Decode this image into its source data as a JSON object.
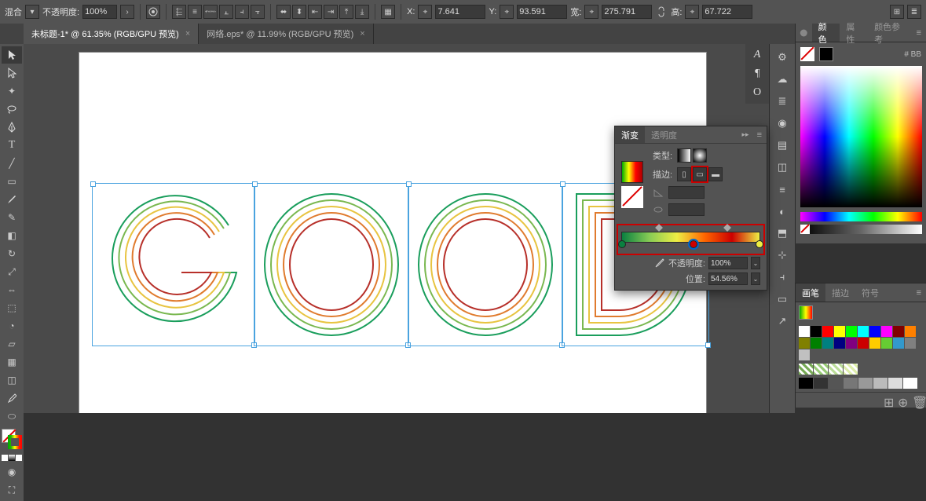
{
  "topbar": {
    "blend_label": "混合",
    "opacity_label": "不透明度:",
    "opacity_value": "100%",
    "x_label": "X:",
    "x_value": "7.641",
    "y_label": "Y:",
    "y_value": "93.591",
    "w_label": "宽:",
    "w_value": "275.791",
    "h_label": "高:",
    "h_value": "67.722"
  },
  "tabs": [
    {
      "label": "未标题-1* @ 61.35% (RGB/GPU 预览)",
      "active": true
    },
    {
      "label": "网络.eps* @ 11.99% (RGB/GPU 预览)",
      "active": false
    }
  ],
  "gradient_panel": {
    "tab_gradient": "渐变",
    "tab_transparency": "透明度",
    "type_label": "类型:",
    "stroke_label": "描边:",
    "opacity_label": "不透明度:",
    "opacity_value": "100%",
    "position_label": "位置:",
    "position_value": "54.56%"
  },
  "color_panel": {
    "tab_color": "颜色",
    "tab_attr": "属性",
    "tab_guide": "颜色参考",
    "hex_prefix": "# ",
    "hex_value": "BB"
  },
  "swatches_panel": {
    "tab_brush": "画笔",
    "tab_stroke": "描边",
    "tab_symbol": "符号"
  },
  "swatch_colors": [
    "#ffffff",
    "#000000",
    "#ff0000",
    "#ffff00",
    "#00ff00",
    "#00ffff",
    "#0000ff",
    "#ff00ff",
    "#800000",
    "#ff8000",
    "#808000",
    "#008000",
    "#008080",
    "#000080",
    "#800080",
    "#c00",
    "#fc0",
    "#6c3",
    "#39c",
    "#808080",
    "#c0c0c0"
  ],
  "gray_row": [
    "#000",
    "#333",
    "#555",
    "#777",
    "#999",
    "#bbb",
    "#ddd",
    "#fff"
  ],
  "pattern_row": [
    "#7a5",
    "#9c7",
    "#bd9",
    "#dea"
  ]
}
